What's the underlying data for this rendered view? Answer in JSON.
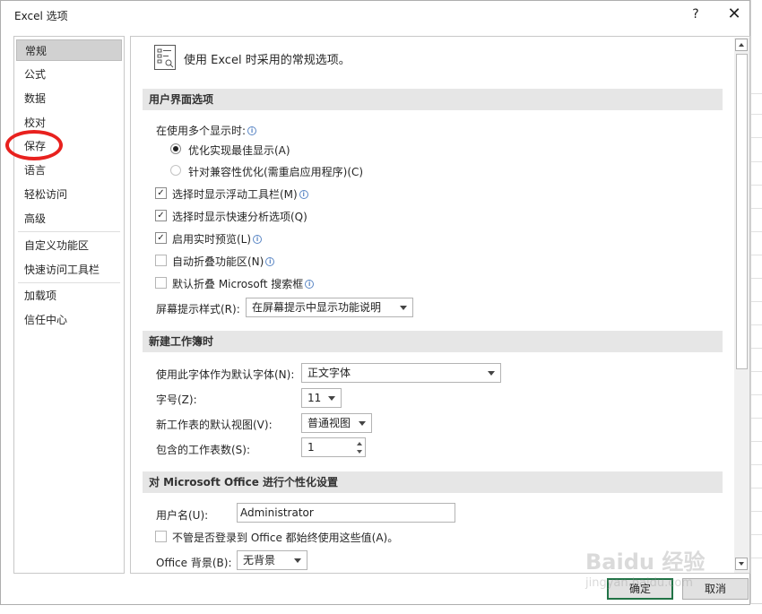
{
  "dialog": {
    "title": "Excel 选项",
    "help_label": "?",
    "close_label": "✕"
  },
  "nav": {
    "items": [
      {
        "label": "常规"
      },
      {
        "label": "公式"
      },
      {
        "label": "数据"
      },
      {
        "label": "校对"
      },
      {
        "label": "保存"
      },
      {
        "label": "语言"
      },
      {
        "label": "轻松访问"
      },
      {
        "label": "高级"
      },
      {
        "label": "自定义功能区"
      },
      {
        "label": "快速访问工具栏"
      },
      {
        "label": "加载项"
      },
      {
        "label": "信任中心"
      }
    ],
    "active": "常规",
    "highlight_color": "#e8211e"
  },
  "general": {
    "intro": "使用 Excel 时采用的常规选项。",
    "ui_section": "用户界面选项",
    "multi_display_label": "在使用多个显示时:",
    "radio_best": "优化实现最佳显示(A)",
    "radio_compat": "针对兼容性优化(需重启应用程序)(C)",
    "check_mini_toolbar": "选择时显示浮动工具栏(M)",
    "check_quick_analysis": "选择时显示快速分析选项(Q)",
    "check_live_preview": "启用实时预览(L)",
    "check_collapse_ribbon": "自动折叠功能区(N)",
    "check_collapse_search": "默认折叠 Microsoft 搜索框",
    "tooltip_style_label": "屏幕提示样式(R):",
    "tooltip_style_value": "在屏幕提示中显示功能说明",
    "new_wb_section": "新建工作簿时",
    "font_label": "使用此字体作为默认字体(N):",
    "font_value": "正文字体",
    "size_label": "字号(Z):",
    "size_value": "11",
    "view_label": "新工作表的默认视图(V):",
    "view_value": "普通视图",
    "sheets_label": "包含的工作表数(S):",
    "sheets_value": "1",
    "personalize_section": "对 Microsoft Office 进行个性化设置",
    "username_label": "用户名(U):",
    "username_value": "Administrator",
    "always_use_label": "不管是否登录到 Office 都始终使用这些值(A)。",
    "background_label": "Office 背景(B):",
    "background_value": "无背景"
  },
  "buttons": {
    "ok": "确定",
    "cancel": "取消"
  },
  "watermark": {
    "text": "Baidu 经验",
    "url": "jingyan.baidu.com"
  },
  "colors": {
    "accent": "#217346",
    "section_bg": "#e6e6e6",
    "nav_active_bg": "#d1d1d1"
  }
}
